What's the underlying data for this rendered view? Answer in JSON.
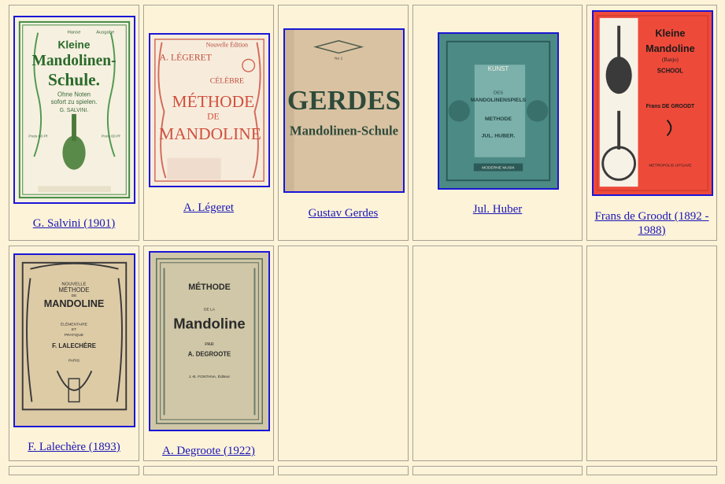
{
  "books": [
    {
      "caption": "G. Salvini (1901)",
      "cover": {
        "lines": [
          "Hanse",
          "Ausgabe",
          "Kleine",
          "Mandolinen-",
          "Schule.",
          "Ohne Noten",
          "sofort zu spielen.",
          "G. SALVINI.",
          "Preis 60 Pf",
          "Preis 60 Pf"
        ]
      }
    },
    {
      "caption": "A. Légeret",
      "cover": {
        "lines": [
          "Nouvelle Édition",
          "A. LÉGERET",
          "CÉLÈBRE",
          "MÉTHODE",
          "DE",
          "MANDOLINE"
        ]
      }
    },
    {
      "caption": "Gustav Gerdes",
      "cover": {
        "lines": [
          "No 1",
          "GERDES",
          "Mandolinen-Schule"
        ]
      }
    },
    {
      "caption": "Jul. Huber",
      "cover": {
        "lines": [
          "KUNST",
          "DES",
          "MANDOLINENSPIELS",
          "METHODE",
          "JUL. HUBER.",
          "MODERNE MUSIK"
        ]
      }
    },
    {
      "caption": "Frans de Groodt (1892 - 1988)",
      "cover": {
        "lines": [
          "Kleine",
          "Mandoline",
          "(Banjo)",
          "SCHOOL",
          "Frans DE GROODT",
          "METROPOLIS UITGAVE"
        ]
      }
    },
    {
      "caption": "F. Lalechère (1893)",
      "cover": {
        "lines": [
          "NOUVELLE",
          "MÉTHODE",
          "DE",
          "MANDOLINE",
          "ÉLÉMENTAIRE",
          "ET",
          "PRATIQUE",
          "F. LALECHÈRE",
          "PARIS"
        ]
      }
    },
    {
      "caption": "A. Degroote (1922)",
      "cover": {
        "lines": [
          "MÉTHODE",
          "DE LA",
          "Mandoline",
          "PAR",
          "A. DEGROOTE",
          "J.-B. FONTANA, Éditeur"
        ]
      }
    }
  ]
}
